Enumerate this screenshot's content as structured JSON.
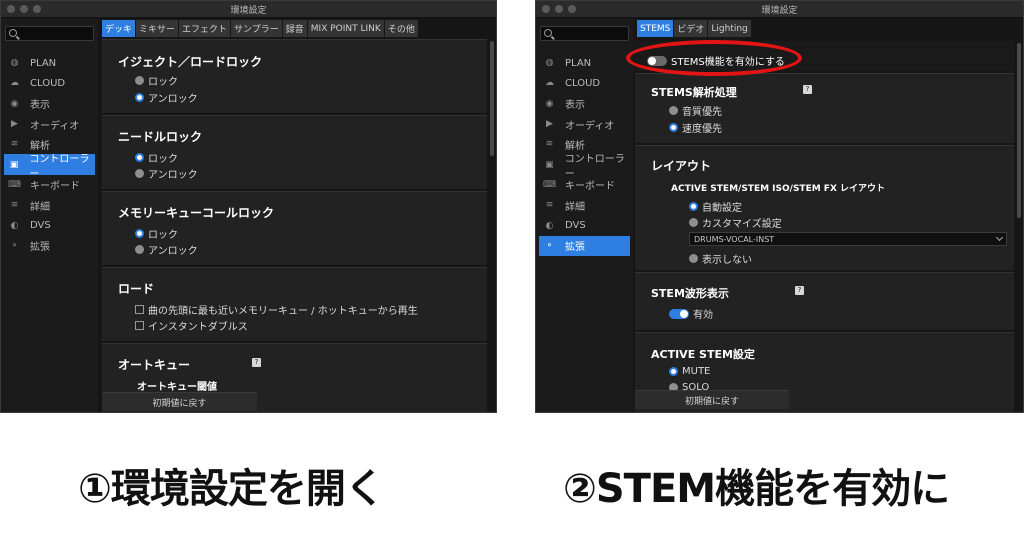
{
  "window_title": "環境設定",
  "left": {
    "tabs": [
      "デッキ",
      "ミキサー",
      "エフェクト",
      "サンプラー",
      "録音",
      "MIX POINT LINK",
      "その他"
    ],
    "sidebar": [
      {
        "label": "PLAN",
        "icon": "plan-icon"
      },
      {
        "label": "CLOUD",
        "icon": "cloud-icon"
      },
      {
        "label": "表示",
        "icon": "eye-icon"
      },
      {
        "label": "オーディオ",
        "icon": "speaker-icon"
      },
      {
        "label": "解析",
        "icon": "waveform-icon"
      },
      {
        "label": "コントローラー",
        "icon": "controller-icon"
      },
      {
        "label": "キーボード",
        "icon": "keyboard-icon"
      },
      {
        "label": "詳細",
        "icon": "list-icon"
      },
      {
        "label": "DVS",
        "icon": "dvs-icon"
      },
      {
        "label": "拡張",
        "icon": "extension-icon"
      }
    ],
    "eject": {
      "title": "イジェクト／ロードロック",
      "options": [
        "ロック",
        "アンロック"
      ]
    },
    "needle": {
      "title": "ニードルロック",
      "options": [
        "ロック",
        "アンロック"
      ]
    },
    "memory": {
      "title": "メモリーキューコールロック",
      "options": [
        "ロック",
        "アンロック"
      ]
    },
    "load": {
      "title": "ロード",
      "options": [
        "曲の先頭に最も近いメモリーキュー / ホットキューから再生",
        "インスタントダブルス"
      ]
    },
    "autocue": {
      "title": "オートキュー",
      "sub": "オートキュー閾値"
    },
    "reset_label": "初期値に戻す"
  },
  "right": {
    "tabs": [
      "STEMS",
      "ビデオ",
      "Lighting"
    ],
    "toggle_label": "STEMS機能を有効にする",
    "analysis": {
      "title": "STEMS解析処理",
      "options": [
        "音質優先",
        "速度優先"
      ]
    },
    "layout": {
      "title": "レイアウト",
      "sub": "ACTIVE STEM/STEM ISO/STEM FX レイアウト",
      "options": [
        "自動設定",
        "カスタマイズ設定",
        "表示しない"
      ],
      "select_value": "DRUMS-VOCAL-INST"
    },
    "waveform": {
      "title": "STEM波形表示",
      "toggle_label": "有効"
    },
    "active": {
      "title": "ACTIVE STEM設定",
      "options": [
        "MUTE",
        "SOLO"
      ]
    },
    "reset_label": "初期値に戻す"
  },
  "help_glyph": "?",
  "captions": [
    "①環境設定を開く",
    "②STEM機能を有効に"
  ],
  "colors": {
    "accent": "#2f7fe3",
    "highlight": "#e31414"
  }
}
